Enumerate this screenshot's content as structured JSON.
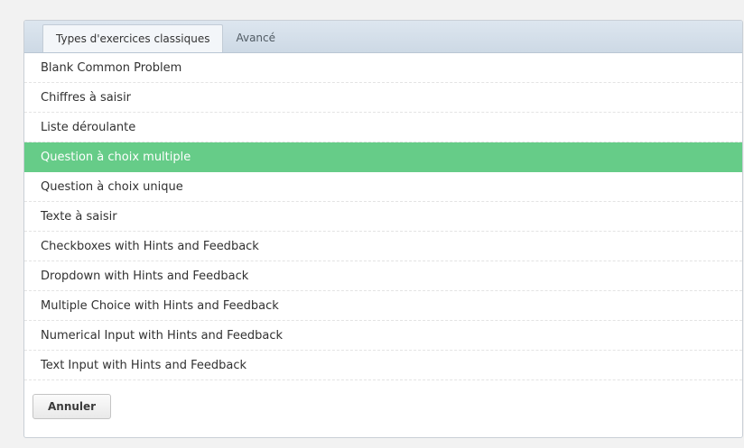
{
  "tabs": [
    {
      "label": "Types d'exercices classiques",
      "active": true
    },
    {
      "label": "Avancé",
      "active": false
    }
  ],
  "items": [
    {
      "label": "Blank Common Problem"
    },
    {
      "label": "Chiffres à saisir"
    },
    {
      "label": "Liste déroulante"
    },
    {
      "label": "Question à choix multiple",
      "selected": true
    },
    {
      "label": "Question à choix unique"
    },
    {
      "label": "Texte à saisir"
    },
    {
      "label": "Checkboxes with Hints and Feedback"
    },
    {
      "label": "Dropdown with Hints and Feedback"
    },
    {
      "label": "Multiple Choice with Hints and Feedback"
    },
    {
      "label": "Numerical Input with Hints and Feedback"
    },
    {
      "label": "Text Input with Hints and Feedback"
    }
  ],
  "footer": {
    "cancel_label": "Annuler"
  },
  "colors": {
    "selected_background": "#66cc88",
    "page_background": "#f2f2f2"
  }
}
